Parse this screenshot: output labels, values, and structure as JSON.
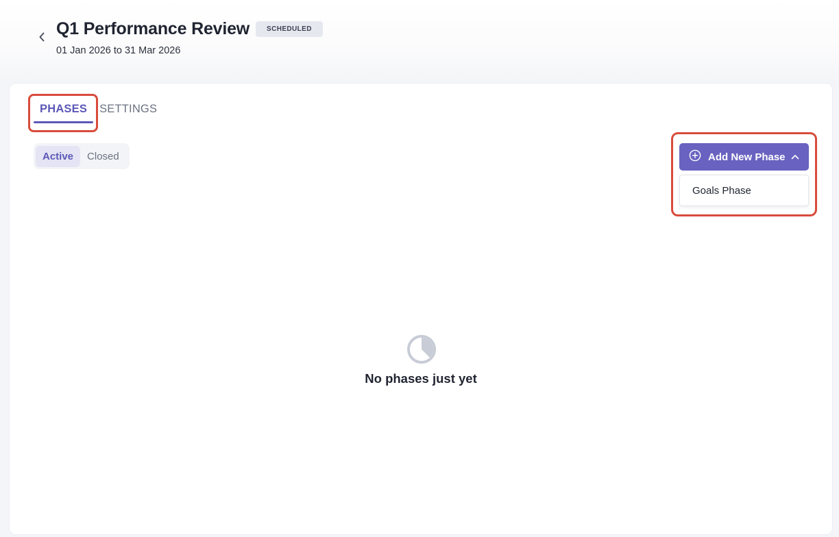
{
  "header": {
    "title": "Q1 Performance Review",
    "status_badge": "SCHEDULED",
    "date_range": "01 Jan 2026 to 31 Mar 2026",
    "back_icon": "chevron-left-icon"
  },
  "tabs": [
    {
      "label": "PHASES",
      "active": true
    },
    {
      "label": "SETTINGS",
      "active": false
    }
  ],
  "filter": {
    "options": [
      {
        "label": "Active",
        "selected": true
      },
      {
        "label": "Closed",
        "selected": false
      }
    ]
  },
  "add_phase": {
    "label": "Add New Phase",
    "icon": "plus-circle-icon",
    "chevron": "chevron-up-icon",
    "menu_open": true,
    "menu_items": [
      {
        "label": "Goals Phase"
      }
    ]
  },
  "empty_state": {
    "icon": "pie-chart-icon",
    "message": "No phases just yet"
  },
  "colors": {
    "accent": "#5c58b7",
    "button": "#6962c0",
    "highlight": "#d84b3c",
    "badge_bg": "#e6e8ef",
    "empty_icon": "#c7ccd6"
  }
}
